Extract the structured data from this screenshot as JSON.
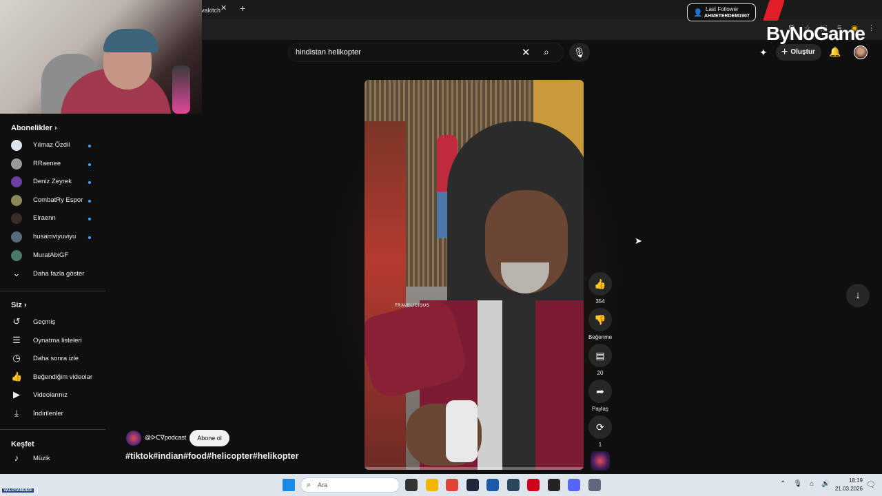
{
  "browser": {
    "tab_title": "vakitch",
    "toolbar_icons": [
      "install-app-icon",
      "star-icon",
      "extensions-icon",
      "media-icon",
      "profile-icon",
      "menu-icon"
    ]
  },
  "overlay": {
    "follower_title": "Last Follower",
    "follower_name": "AHMETERDEM1907",
    "logo_text": "ByNoGame"
  },
  "header": {
    "search_value": "hindistan helikopter",
    "create_label": "Oluştur"
  },
  "sidebar": {
    "subscriptions_title": "Abonelikler",
    "subscriptions": [
      {
        "name": "Yılmaz Özdil",
        "new": true,
        "avatar_color": "#dfe3ea"
      },
      {
        "name": "RRaenee",
        "new": true,
        "avatar_color": "#9a9a9a"
      },
      {
        "name": "Deniz Zeyrek",
        "new": true,
        "avatar_color": "#6a3fa0"
      },
      {
        "name": "CombatRy Espor",
        "new": true,
        "avatar_color": "#8a8a58"
      },
      {
        "name": "Elraenn",
        "new": true,
        "avatar_color": "#3a2a2a"
      },
      {
        "name": "husamviyuviyu",
        "new": true,
        "avatar_color": "#5a6a7a"
      },
      {
        "name": "MuratAbiGF",
        "new": false,
        "avatar_color": "#4a7a6a"
      }
    ],
    "show_more": "Daha fazla göster",
    "you_title": "Siz",
    "you_items": [
      {
        "label": "Geçmiş",
        "icon": "history-icon",
        "glyph": "↺"
      },
      {
        "label": "Oynatma listeleri",
        "icon": "playlist-icon",
        "glyph": "☰"
      },
      {
        "label": "Daha sonra izle",
        "icon": "clock-icon",
        "glyph": "◷"
      },
      {
        "label": "Beğendiğim videolar",
        "icon": "thumb-up-icon",
        "glyph": "👍"
      },
      {
        "label": "Videolarınız",
        "icon": "video-icon",
        "glyph": "▶"
      },
      {
        "label": "İndirilenler",
        "icon": "download-icon",
        "glyph": "⤓"
      }
    ],
    "explore_title": "Keşfet",
    "explore_items": [
      {
        "label": "Müzik",
        "icon": "music-icon",
        "glyph": "♪"
      }
    ]
  },
  "video": {
    "watermark": "TRAVELICIOUS",
    "progress": 0.0
  },
  "actions": {
    "like_count": "354",
    "dislike_label": "Beğenme",
    "comment_count": "20",
    "share_label": "Paylaş",
    "remix_count": "1"
  },
  "channel": {
    "handle": "@ᐅᑕᐁpodcast",
    "subscribe_label": "Abone ol",
    "hashtags": "#tiktok#indian#food#helicopter#helikopter"
  },
  "taskbar": {
    "search_placeholder": "Ara",
    "time": "18:19",
    "date": "21.03.2026",
    "apps": [
      {
        "name": "task-view-icon",
        "color": "#333333"
      },
      {
        "name": "file-explorer-icon",
        "color": "#f2b705"
      },
      {
        "name": "chrome-icon",
        "color": "#db4437"
      },
      {
        "name": "steam-icon",
        "color": "#1b2838"
      },
      {
        "name": "store-icon",
        "color": "#1a5aa8"
      },
      {
        "name": "steam-2-icon",
        "color": "#2a475e"
      },
      {
        "name": "app-red-icon",
        "color": "#d0021b"
      },
      {
        "name": "app-dark-icon",
        "color": "#222222"
      },
      {
        "name": "discord-icon",
        "color": "#5865f2"
      },
      {
        "name": "settings-icon",
        "color": "#5f6b7a"
      }
    ]
  },
  "corner": {
    "brand": "VALOTANDIZE"
  }
}
